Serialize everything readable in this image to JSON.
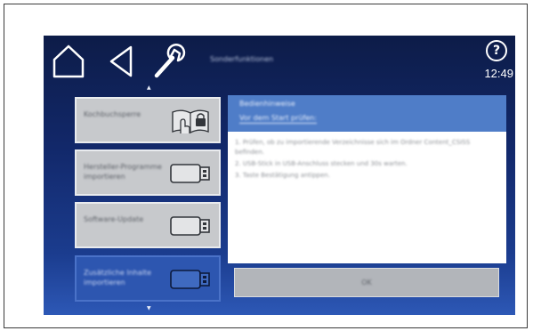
{
  "header": {
    "title": "Sonderfunktionen",
    "help_label": "?",
    "clock": "12:49",
    "icons": [
      "home-icon",
      "back-icon",
      "wrench-icon"
    ]
  },
  "menu": {
    "items": [
      {
        "label": "Kochbuchsperre",
        "icon": "book-lock-icon",
        "selected": false
      },
      {
        "label": "Hersteller-Programme importieren",
        "icon": "usb-stick-icon",
        "selected": false
      },
      {
        "label": "Software-Update",
        "icon": "usb-stick-icon",
        "selected": false
      },
      {
        "label": "Zusätzliche Inhalte importieren",
        "icon": "usb-stick-icon",
        "selected": true
      }
    ]
  },
  "panel": {
    "title": "Bedienhinweise",
    "subtitle": "Vor dem Start prüfen:",
    "instructions": [
      "1. Prüfen, ob zu importierende Verzeichnisse sich im Ordner Content_CSISS befinden.",
      "2. USB-Stick in USB-Anschluss stecken und 30s warten.",
      "3. Taste Bestätigung antippen."
    ]
  },
  "ok_button": {
    "label": "OK"
  },
  "colors": {
    "screen_top": "#0d1c48",
    "screen_bottom": "#2d58b6",
    "menu_item": "#c7c9cc",
    "menu_selected": "#2d56b0",
    "panel_header": "#4f7dc8",
    "ok_button": "#b2b5ba"
  }
}
